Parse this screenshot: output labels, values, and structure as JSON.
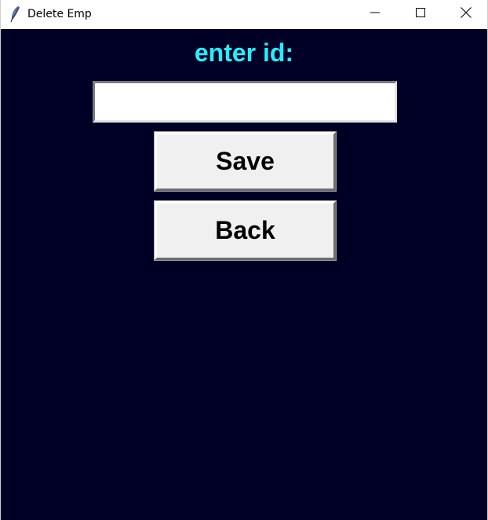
{
  "window": {
    "title": "Delete Emp",
    "icon": "feather-icon",
    "controls": {
      "minimize_icon": "minimize-icon",
      "maximize_icon": "maximize-icon",
      "close_icon": "close-icon"
    }
  },
  "form": {
    "prompt_label": "enter id:",
    "id_input_value": "",
    "save_label": "Save",
    "back_label": "Back"
  },
  "colors": {
    "background": "#000026",
    "label": "#22f0ff",
    "button_face": "#f0f0f0"
  }
}
